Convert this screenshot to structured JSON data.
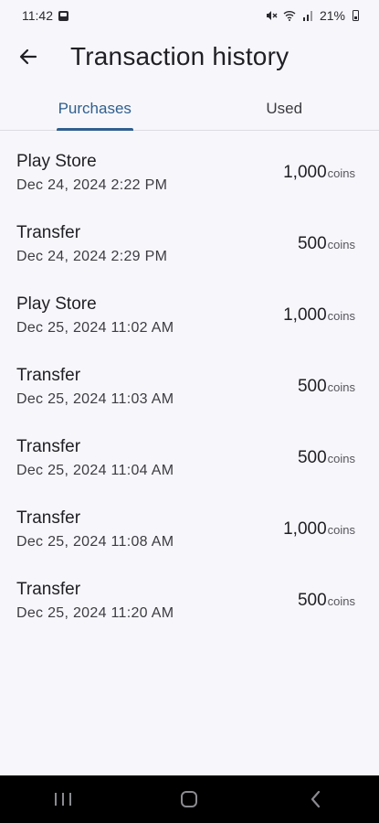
{
  "status_bar": {
    "time": "11:42",
    "battery": "21%",
    "icons": [
      "image-notification-icon",
      "mute-icon",
      "wifi-icon",
      "signal-icon",
      "battery-icon"
    ]
  },
  "header": {
    "title": "Transaction history",
    "back_icon": "back-arrow-icon"
  },
  "tabs": [
    {
      "label": "Purchases",
      "active": true
    },
    {
      "label": "Used",
      "active": false
    }
  ],
  "transactions": [
    {
      "title": "Play Store",
      "date": "Dec 24, 2024 2:22 PM",
      "amount": "1,000",
      "unit": "coins"
    },
    {
      "title": "Transfer",
      "date": "Dec 24, 2024 2:29 PM",
      "amount": "500",
      "unit": "coins"
    },
    {
      "title": "Play Store",
      "date": "Dec 25, 2024 11:02 AM",
      "amount": "1,000",
      "unit": "coins"
    },
    {
      "title": "Transfer",
      "date": "Dec 25, 2024 11:03 AM",
      "amount": "500",
      "unit": "coins"
    },
    {
      "title": "Transfer",
      "date": "Dec 25, 2024 11:04 AM",
      "amount": "500",
      "unit": "coins"
    },
    {
      "title": "Transfer",
      "date": "Dec 25, 2024 11:08 AM",
      "amount": "1,000",
      "unit": "coins"
    },
    {
      "title": "Transfer",
      "date": "Dec 25, 2024 11:20 AM",
      "amount": "500",
      "unit": "coins"
    }
  ],
  "nav_bar": {
    "icons": [
      "recent-apps-icon",
      "home-icon",
      "back-icon"
    ]
  },
  "colors": {
    "background": "#f7f7fb",
    "accent": "#2f5f8f",
    "nav_bar": "#000000"
  }
}
